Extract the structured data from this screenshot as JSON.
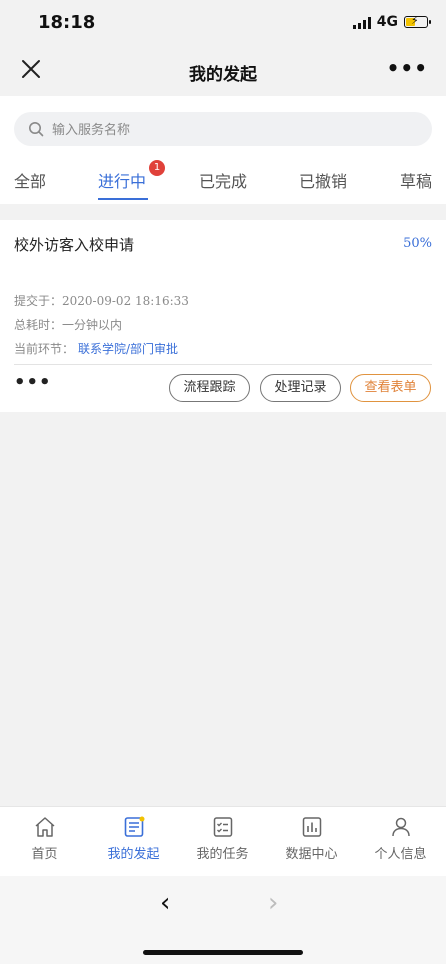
{
  "status_bar": {
    "time": "18:18",
    "network": "4G"
  },
  "nav": {
    "title": "我的发起"
  },
  "search": {
    "placeholder": "输入服务名称"
  },
  "tabs": [
    {
      "label": "全部"
    },
    {
      "label": "进行中",
      "badge": "1",
      "active": true
    },
    {
      "label": "已完成"
    },
    {
      "label": "已撤销"
    },
    {
      "label": "草稿"
    }
  ],
  "card": {
    "title": "校外访客入校申请",
    "progress": "50%",
    "submitted_label": "提交于：",
    "submitted_value": "2020-09-02 18:16:33",
    "duration_label": "总耗时：",
    "duration_value": "一分钟以内",
    "stage_label": "当前环节：",
    "stage_value": "联系学院/部门审批",
    "more_label": "•••",
    "buttons": {
      "track": "流程跟踪",
      "records": "处理记录",
      "view_form": "查看表单"
    }
  },
  "tabbar": [
    {
      "label": "首页",
      "icon": "home-icon"
    },
    {
      "label": "我的发起",
      "icon": "document-icon",
      "active": true
    },
    {
      "label": "我的任务",
      "icon": "task-list-icon"
    },
    {
      "label": "数据中心",
      "icon": "bar-chart-icon"
    },
    {
      "label": "个人信息",
      "icon": "person-icon"
    }
  ],
  "browser": {
    "back": "‹",
    "forward": "›"
  },
  "colors": {
    "accent": "#3a6fd8",
    "badge": "#e0413a",
    "orange": "#e0833a",
    "battery": "#f2c200"
  }
}
